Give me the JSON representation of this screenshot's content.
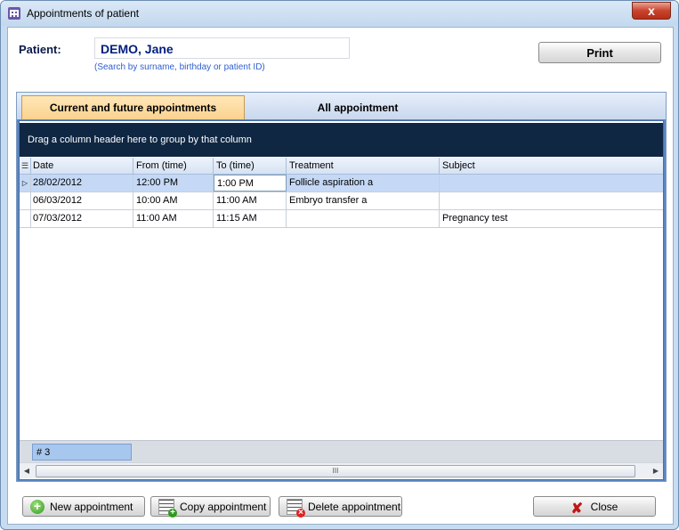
{
  "window": {
    "title": "Appointments of patient",
    "close_glyph": "x"
  },
  "patient": {
    "label": "Patient:",
    "name": "DEMO, Jane",
    "hint": "(Search by surname, birthday or patient ID)"
  },
  "toolbar": {
    "print_label": "Print"
  },
  "tabs": [
    {
      "label": "Current and future appointments",
      "active": true
    },
    {
      "label": "All appointment",
      "active": false
    }
  ],
  "grid": {
    "group_hint": "Drag a column header here to group by that column",
    "columns": [
      "Date",
      "From (time)",
      "To (time)",
      "Treatment",
      "Subject"
    ],
    "rows": [
      {
        "date": "28/02/2012",
        "from": "12:00 PM",
        "to": "1:00 PM",
        "treatment": "Follicle aspiration a",
        "subject": ""
      },
      {
        "date": "06/03/2012",
        "from": "10:00 AM",
        "to": "11:00 AM",
        "treatment": "Embryo transfer a",
        "subject": ""
      },
      {
        "date": "07/03/2012",
        "from": "11:00 AM",
        "to": "11:15 AM",
        "treatment": "",
        "subject": "Pregnancy test"
      }
    ],
    "footer_count": "# 3",
    "scroll_grip": "III"
  },
  "buttons": {
    "new": "New appointment",
    "copy": "Copy appointment",
    "delete": "Delete appointment",
    "close": "Close"
  },
  "colors": {
    "active_tab": "#fbd28f",
    "group_bar": "#0f2743",
    "selected_row": "#c5d9f6"
  }
}
